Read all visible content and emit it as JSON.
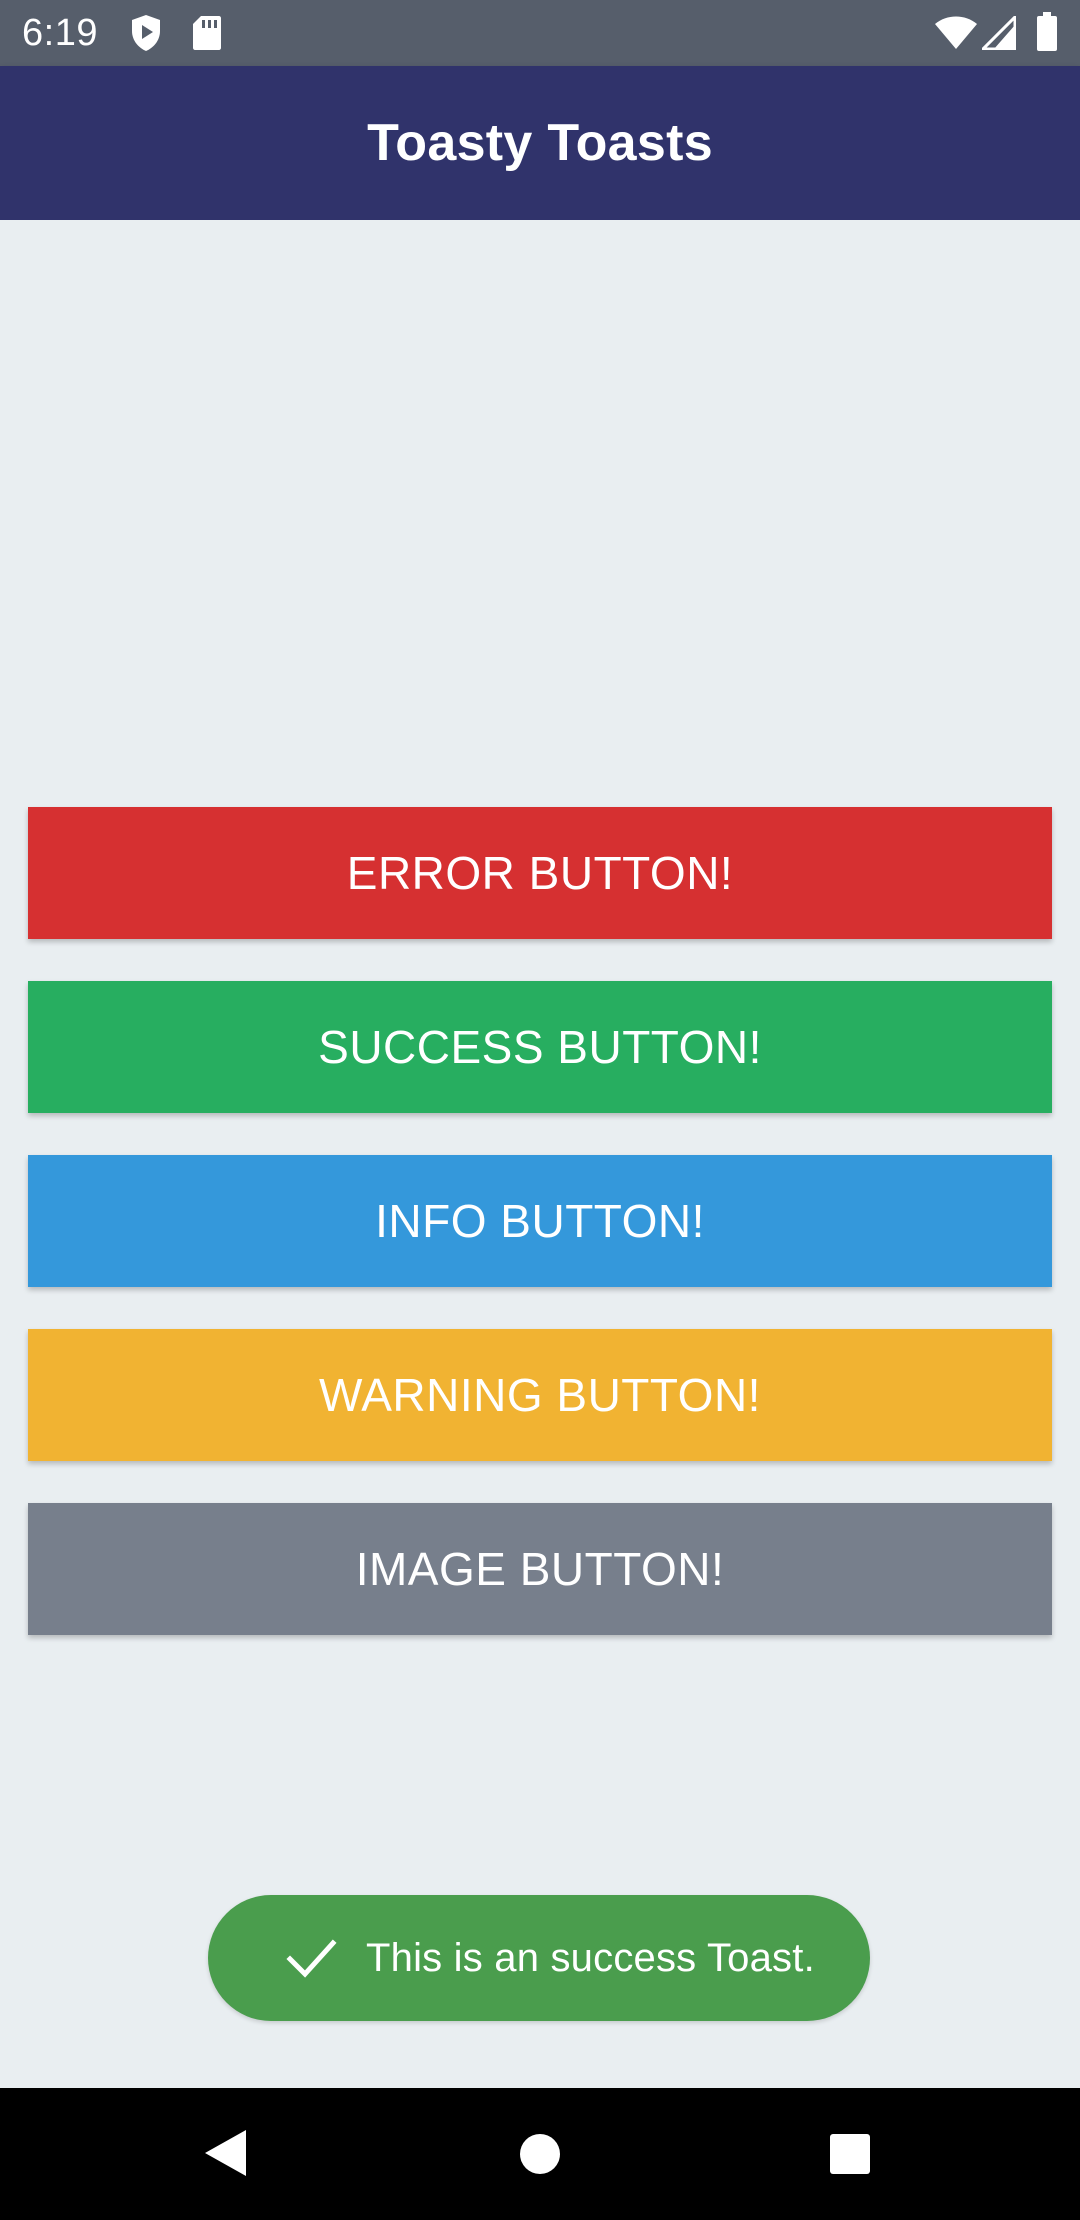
{
  "status_bar": {
    "time": "6:19",
    "icons": [
      "shield-play-icon",
      "sd-card-icon",
      "wifi-icon",
      "cellular-signal-icon",
      "battery-icon"
    ]
  },
  "app_bar": {
    "title": "Toasty Toasts",
    "color": "#30336b"
  },
  "buttons": [
    {
      "label": "ERROR BUTTON!",
      "color": "#d63031"
    },
    {
      "label": "SUCCESS BUTTON!",
      "color": "#27ae60"
    },
    {
      "label": "INFO BUTTON!",
      "color": "#3498db"
    },
    {
      "label": "WARNING BUTTON!",
      "color": "#f1b332"
    },
    {
      "label": "IMAGE BUTTON!",
      "color": "#777f8c"
    }
  ],
  "toast": {
    "text": "This is an success Toast.",
    "icon": "checkmark-icon",
    "color": "#4a9d4d"
  },
  "nav_bar": {
    "icons": [
      "back-icon",
      "home-icon",
      "recents-icon"
    ]
  },
  "colors": {
    "background": "#e9eef1",
    "status_bar": "#565e6b"
  }
}
